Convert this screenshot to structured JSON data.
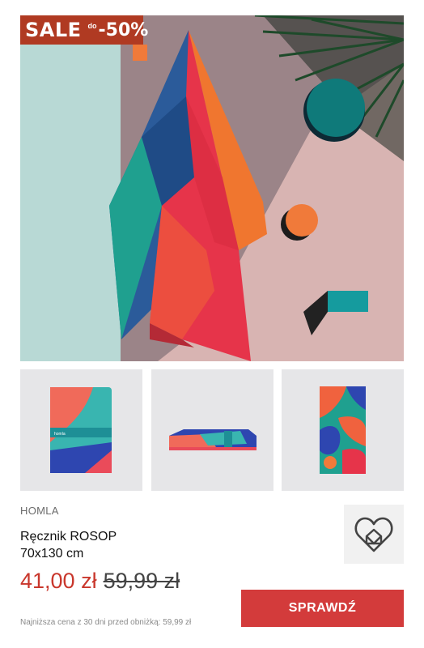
{
  "badge": {
    "word": "SALE",
    "prefix": "do",
    "percent": "-50%"
  },
  "product": {
    "brand": "HOMLA",
    "name_line1": "Ręcznik ROSOP",
    "name_line2": "70x130 cm",
    "price_current": "41,00 zł",
    "price_old": "59,99 zł",
    "lowest_price_note": "Najniższa cena z 30 dni przed obniżką: 59,99 zł"
  },
  "actions": {
    "check_label": "SPRAWDŹ"
  },
  "colors": {
    "accent": "#d33b3b",
    "sale_badge": "#b03a22",
    "price": "#c9372c"
  },
  "icons": {
    "favorite": "heart-home-icon"
  }
}
